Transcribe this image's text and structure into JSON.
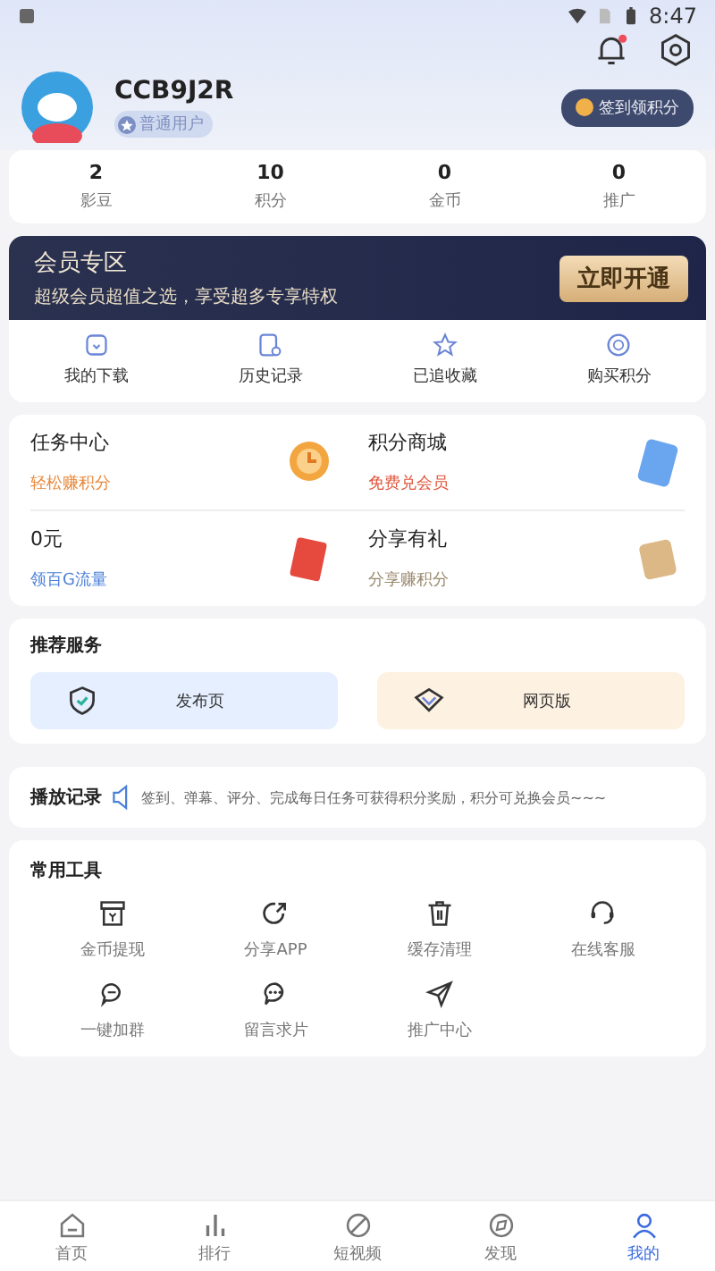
{
  "status_bar": {
    "time": "8:47"
  },
  "profile": {
    "name": "CCB9J2R",
    "badge": "普通用户",
    "sign_in": "签到领积分",
    "notification": true
  },
  "stats": [
    {
      "value": "2",
      "label": "影豆"
    },
    {
      "value": "10",
      "label": "积分"
    },
    {
      "value": "0",
      "label": "金币"
    },
    {
      "value": "0",
      "label": "推广"
    }
  ],
  "vip_banner": {
    "title": "会员专区",
    "subtitle": "超级会员超值之选，享受超多专享特权",
    "button": "立即开通"
  },
  "shortcuts": [
    "我的下载",
    "历史记录",
    "已追收藏",
    "购买积分"
  ],
  "features": [
    {
      "title": "任务中心",
      "subtitle": "轻松赚积分",
      "color": "#e8883a"
    },
    {
      "title": "积分商城",
      "subtitle": "免费兑会员",
      "color": "#e0553a"
    },
    {
      "title": "0元",
      "subtitle": "领百G流量",
      "color": "#4a7fd8"
    },
    {
      "title": "分享有礼",
      "subtitle": "分享赚积分",
      "color": "#9a8a70"
    }
  ],
  "recommended": {
    "title": "推荐服务",
    "items": [
      "发布页",
      "网页版"
    ]
  },
  "broadcast": {
    "title": "播放记录",
    "text": "签到、弹幕、评分、完成每日任务可获得积分奖励，积分可兑换会员~~~"
  },
  "tools": {
    "title": "常用工具",
    "items": [
      "金币提现",
      "分享APP",
      "缓存清理",
      "在线客服",
      "一键加群",
      "留言求片",
      "推广中心"
    ]
  },
  "tabs": [
    {
      "label": "首页",
      "selected": false
    },
    {
      "label": "排行",
      "selected": false
    },
    {
      "label": "短视频",
      "selected": false
    },
    {
      "label": "发现",
      "selected": false
    },
    {
      "label": "我的",
      "selected": true
    }
  ]
}
